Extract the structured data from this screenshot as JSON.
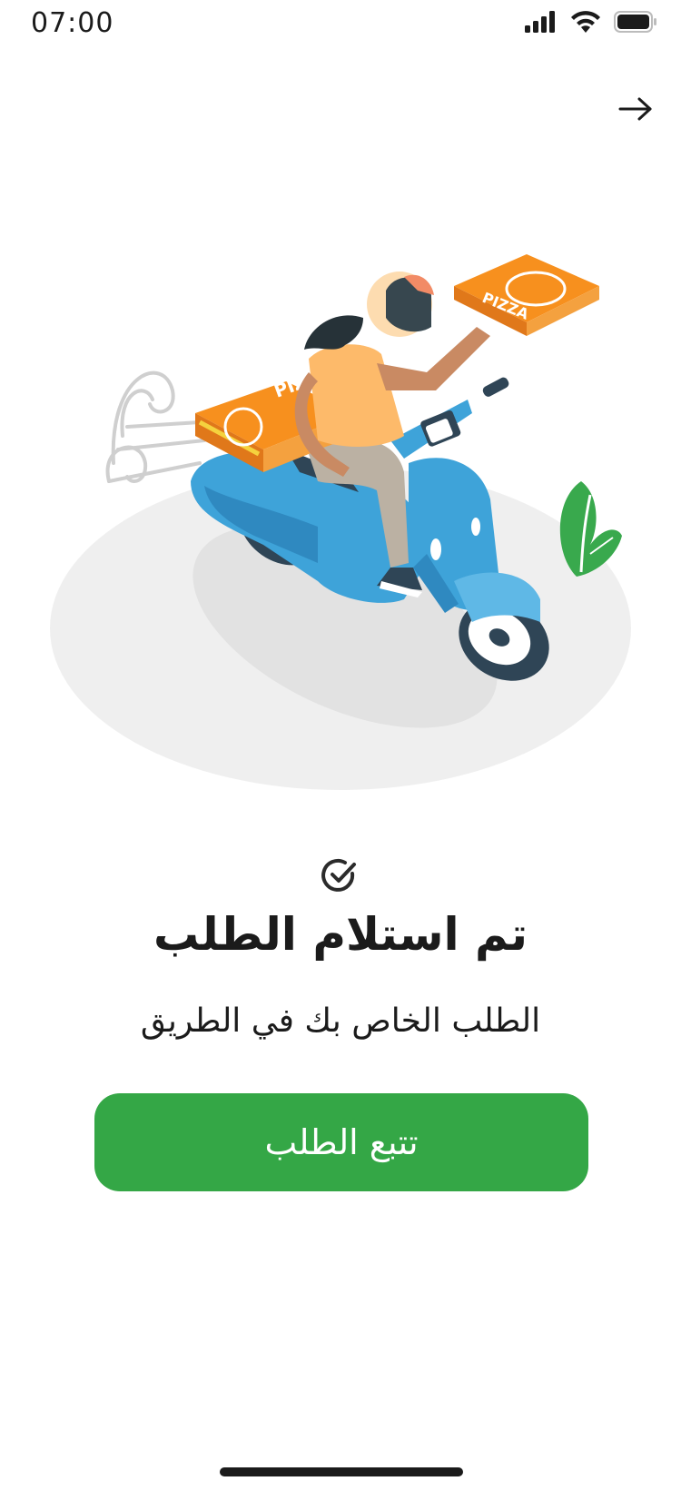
{
  "status_bar": {
    "time": "07:00",
    "icons": [
      "signal-icon",
      "wifi-icon",
      "battery-icon"
    ]
  },
  "nav": {
    "back_icon": "arrow-right-icon"
  },
  "illustration": {
    "box_text": "PIZZA"
  },
  "confirmation": {
    "icon": "check-circle-icon",
    "title": "تم استلام الطلب",
    "subtitle": "الطلب الخاص بك في الطريق"
  },
  "actions": {
    "track_label": "تتبع الطلب"
  },
  "colors": {
    "primary": "#34a746",
    "scooter": "#3ea3d9",
    "box": "#f7901e",
    "text": "#1b1b1b"
  }
}
